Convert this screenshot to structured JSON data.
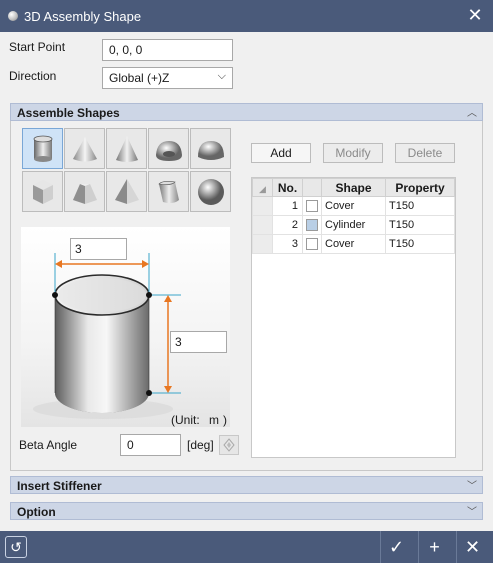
{
  "window": {
    "title": "3D Assembly Shape",
    "close_icon": "close-icon"
  },
  "start_point": {
    "label": "Start Point",
    "value": "0, 0, 0"
  },
  "direction": {
    "label": "Direction",
    "value": "Global (+)Z"
  },
  "sections": {
    "assemble": "Assemble Shapes",
    "stiffener": "Insert Stiffener",
    "option": "Option"
  },
  "shape_buttons": [
    "cylinder-icon",
    "cone-icon",
    "pointed-cone-icon",
    "torus-segment-icon",
    "dome-icon",
    "cube-icon",
    "frustum-icon",
    "pyramid-icon",
    "elliptic-cylinder-icon",
    "sphere-icon"
  ],
  "preview": {
    "width_value": "3",
    "height_value": "3",
    "unit_label": "(Unit:",
    "unit_value": "m",
    "unit_close": ")"
  },
  "beta": {
    "label": "Beta Angle",
    "value": "0",
    "unit": "[deg]"
  },
  "buttons": {
    "add": "Add",
    "modify": "Modify",
    "delete": "Delete"
  },
  "table": {
    "headers": [
      "No.",
      "Shape",
      "Property"
    ],
    "rows": [
      {
        "no": "1",
        "checked": false,
        "shape": "Cover",
        "property": "T150"
      },
      {
        "no": "2",
        "checked": true,
        "shape": "Cylinder",
        "property": "T150"
      },
      {
        "no": "3",
        "checked": false,
        "shape": "Cover",
        "property": "T150"
      }
    ]
  },
  "colors": {
    "titlebar": "#4a5a7a",
    "section_header": "#cdd6e6",
    "dimension_arrow": "#e87722",
    "dimension_line": "#3aa5c9"
  }
}
